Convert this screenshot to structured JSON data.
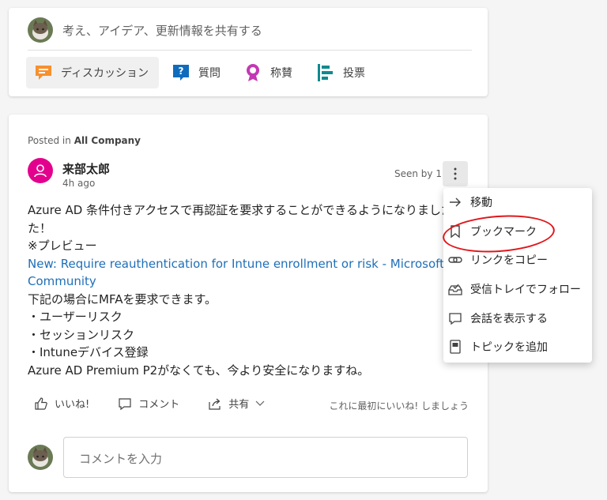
{
  "composer": {
    "placeholder": "考え、アイデア、更新情報を共有する",
    "tabs": [
      {
        "label": "ディスカッション",
        "icon": "discussion-icon",
        "color": "#f7902d"
      },
      {
        "label": "質問",
        "icon": "question-icon",
        "color": "#0f6cbd"
      },
      {
        "label": "称賛",
        "icon": "praise-icon",
        "color": "#c239b3"
      },
      {
        "label": "投票",
        "icon": "poll-icon",
        "color": "#0f8a8f"
      }
    ]
  },
  "post": {
    "posted_prefix": "Posted in",
    "group": "All Company",
    "author": "来部太郎",
    "time": "4h ago",
    "seen": "Seen by 1",
    "avatar_color": "#e3008c",
    "body": {
      "line1": "Azure AD 条件付きアクセスで再認証を要求することができるようになりました",
      "line2": "た！",
      "line3": "※プレビュー",
      "link1": "New: Require reauthentication for Intune enrollment or risk - Microsoft Tech",
      "link2": "Community",
      "line4": "下記の場合にMFAを要求できます。",
      "line5": "・ユーザーリスク",
      "line6": "・セッションリスク",
      "line7": "・Intuneデバイス登録",
      "line8": "Azure AD Premium P2がなくても、今より安全になりますね。"
    },
    "actions": {
      "like": "いいね!",
      "comment": "コメント",
      "share": "共有"
    },
    "like_hint": "これに最初にいいね! しましょう",
    "comment_placeholder": "コメントを入力"
  },
  "menu": {
    "items": [
      {
        "label": "移動",
        "icon": "arrow-right-icon"
      },
      {
        "label": "ブックマーク",
        "icon": "bookmark-icon"
      },
      {
        "label": "リンクをコピー",
        "icon": "link-icon"
      },
      {
        "label": "受信トレイでフォロー",
        "icon": "inbox-follow-icon"
      },
      {
        "label": "会話を表示する",
        "icon": "conversation-icon"
      },
      {
        "label": "トピックを追加",
        "icon": "topic-icon"
      }
    ]
  }
}
